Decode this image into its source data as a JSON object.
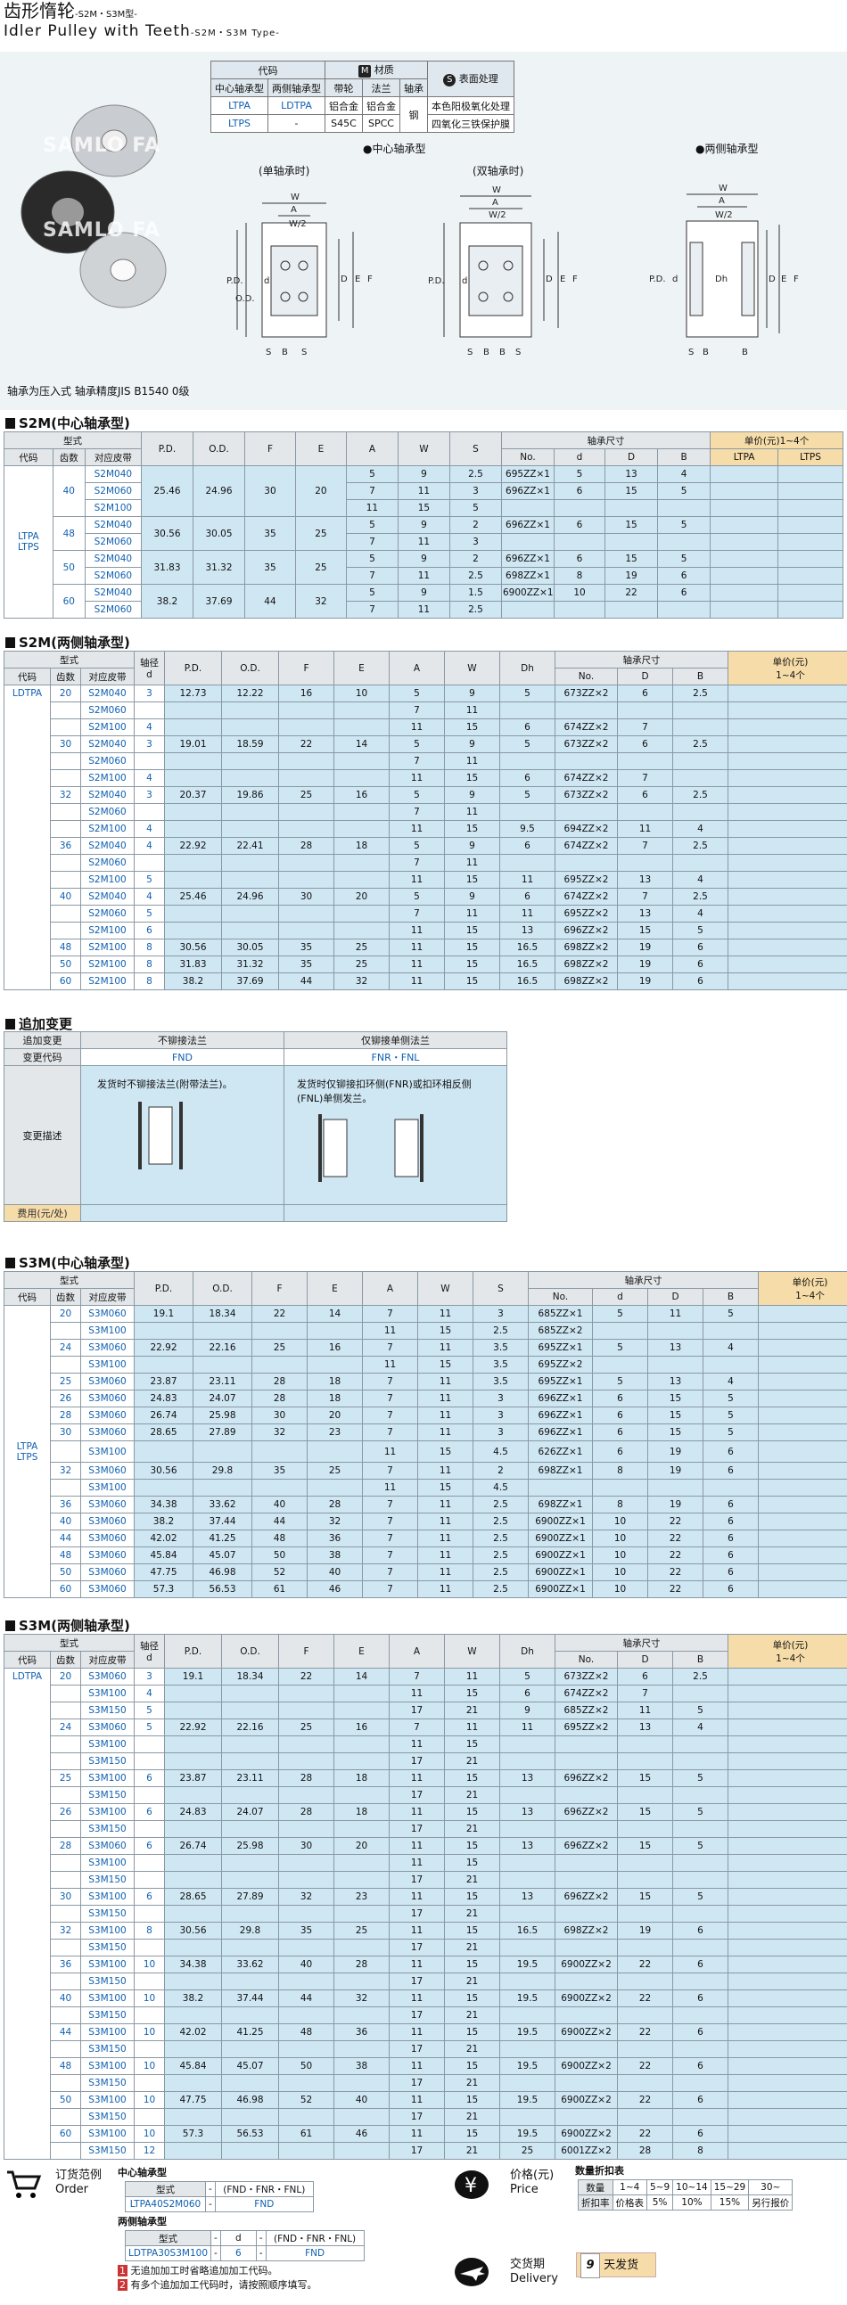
{
  "header": {
    "title_cn": "齿形惰轮",
    "title_cn_suffix": "-S2M・S3M型-",
    "title_en": "Idler Pulley with Teeth",
    "title_en_suffix": "-S2M・S3M Type-"
  },
  "materials": {
    "code": "代码",
    "material": "材质",
    "surface": "表面处理",
    "center_type": "中心轴承型",
    "both_type": "两侧轴承型",
    "belt": "带轮",
    "flange": "法兰",
    "bearing": "轴承",
    "rows": [
      [
        "LTPA",
        "LDTPA",
        "铝合金",
        "铝合金",
        "钢",
        "本色阳极氧化处理"
      ],
      [
        "LTPS",
        "-",
        "S45C",
        "SPCC",
        "",
        "四氧化三铁保护膜"
      ]
    ]
  },
  "drawings": {
    "center": "●中心轴承型",
    "both": "●两侧轴承型",
    "single": "(单轴承时)",
    "double": "(双轴承时)"
  },
  "bearing_note": "轴承为压入式 轴承精度JIS B1540 0级",
  "s2m_center": {
    "title": "S2M(中心轴承型)",
    "type": "型式",
    "code": "代码",
    "teeth": "齿数",
    "belt": "对应皮带",
    "pd": "P.D.",
    "od": "O.D.",
    "f": "F",
    "e": "E",
    "a": "A",
    "w": "W",
    "s": "S",
    "bearing": "轴承尺寸",
    "no": "No.",
    "d": "d",
    "D": "D",
    "B": "B",
    "price": "单价(元)1~4个",
    "p1": "LTPA",
    "p2": "LTPS",
    "codes": [
      "LTPA",
      "LTPS"
    ],
    "groups": [
      {
        "teeth": "40",
        "pd": "25.46",
        "od": "24.96",
        "f": "30",
        "e": "20",
        "rows": [
          [
            "S2M040",
            "5",
            "9",
            "2.5",
            "695ZZ×1",
            "5",
            "13",
            "4"
          ],
          [
            "S2M060",
            "7",
            "11",
            "3",
            "696ZZ×1",
            "6",
            "15",
            "5"
          ],
          [
            "S2M100",
            "11",
            "15",
            "5",
            "",
            "",
            "",
            ""
          ]
        ]
      },
      {
        "teeth": "48",
        "pd": "30.56",
        "od": "30.05",
        "f": "35",
        "e": "25",
        "rows": [
          [
            "S2M040",
            "5",
            "9",
            "2",
            "696ZZ×1",
            "6",
            "15",
            "5"
          ],
          [
            "S2M060",
            "7",
            "11",
            "3",
            "",
            "",
            "",
            ""
          ]
        ]
      },
      {
        "teeth": "50",
        "pd": "31.83",
        "od": "31.32",
        "f": "35",
        "e": "25",
        "rows": [
          [
            "S2M040",
            "5",
            "9",
            "2",
            "696ZZ×1",
            "6",
            "15",
            "5"
          ],
          [
            "S2M060",
            "7",
            "11",
            "2.5",
            "698ZZ×1",
            "8",
            "19",
            "6"
          ]
        ]
      },
      {
        "teeth": "60",
        "pd": "38.2",
        "od": "37.69",
        "f": "44",
        "e": "32",
        "rows": [
          [
            "S2M040",
            "5",
            "9",
            "1.5",
            "6900ZZ×1",
            "10",
            "22",
            "6"
          ],
          [
            "S2M060",
            "7",
            "11",
            "2.5",
            "",
            "",
            "",
            ""
          ]
        ]
      }
    ]
  },
  "s2m_both": {
    "title": "S2M(两侧轴承型)",
    "shaft": "轴径",
    "price": "单价(元)",
    "price2": "1~4个",
    "dh": "Dh",
    "code": "LDTPA",
    "rows": [
      [
        "20",
        "S2M040",
        "3",
        "12.73",
        "12.22",
        "16",
        "10",
        "5",
        "9",
        "5",
        "673ZZ×2",
        "6",
        "2.5"
      ],
      [
        "",
        "S2M060",
        "",
        "",
        "",
        "",
        "",
        "7",
        "11",
        "",
        "",
        "",
        ""
      ],
      [
        "",
        "S2M100",
        "4",
        "",
        "",
        "",
        "",
        "11",
        "15",
        "6",
        "674ZZ×2",
        "7",
        ""
      ],
      [
        "30",
        "S2M040",
        "3",
        "19.01",
        "18.59",
        "22",
        "14",
        "5",
        "9",
        "5",
        "673ZZ×2",
        "6",
        "2.5"
      ],
      [
        "",
        "S2M060",
        "",
        "",
        "",
        "",
        "",
        "7",
        "11",
        "",
        "",
        "",
        ""
      ],
      [
        "",
        "S2M100",
        "4",
        "",
        "",
        "",
        "",
        "11",
        "15",
        "6",
        "674ZZ×2",
        "7",
        ""
      ],
      [
        "32",
        "S2M040",
        "3",
        "20.37",
        "19.86",
        "25",
        "16",
        "5",
        "9",
        "5",
        "673ZZ×2",
        "6",
        "2.5"
      ],
      [
        "",
        "S2M060",
        "",
        "",
        "",
        "",
        "",
        "7",
        "11",
        "",
        "",
        "",
        ""
      ],
      [
        "",
        "S2M100",
        "4",
        "",
        "",
        "",
        "",
        "11",
        "15",
        "9.5",
        "694ZZ×2",
        "11",
        "4"
      ],
      [
        "36",
        "S2M040",
        "4",
        "22.92",
        "22.41",
        "28",
        "18",
        "5",
        "9",
        "6",
        "674ZZ×2",
        "7",
        "2.5"
      ],
      [
        "",
        "S2M060",
        "",
        "",
        "",
        "",
        "",
        "7",
        "11",
        "",
        "",
        "",
        ""
      ],
      [
        "",
        "S2M100",
        "5",
        "",
        "",
        "",
        "",
        "11",
        "15",
        "11",
        "695ZZ×2",
        "13",
        "4"
      ],
      [
        "40",
        "S2M040",
        "4",
        "25.46",
        "24.96",
        "30",
        "20",
        "5",
        "9",
        "6",
        "674ZZ×2",
        "7",
        "2.5"
      ],
      [
        "",
        "S2M060",
        "5",
        "",
        "",
        "",
        "",
        "7",
        "11",
        "11",
        "695ZZ×2",
        "13",
        "4"
      ],
      [
        "",
        "S2M100",
        "6",
        "",
        "",
        "",
        "",
        "11",
        "15",
        "13",
        "696ZZ×2",
        "15",
        "5"
      ],
      [
        "48",
        "S2M100",
        "8",
        "30.56",
        "30.05",
        "35",
        "25",
        "11",
        "15",
        "16.5",
        "698ZZ×2",
        "19",
        "6"
      ],
      [
        "50",
        "S2M100",
        "8",
        "31.83",
        "31.32",
        "35",
        "25",
        "11",
        "15",
        "16.5",
        "698ZZ×2",
        "19",
        "6"
      ],
      [
        "60",
        "S2M100",
        "8",
        "38.2",
        "37.69",
        "44",
        "32",
        "11",
        "15",
        "16.5",
        "698ZZ×2",
        "19",
        "6"
      ]
    ]
  },
  "alteration": {
    "title": "追加变更",
    "item": "追加变更",
    "opt1": "不铆接法兰",
    "opt2": "仅铆接单侧法兰",
    "code_label": "变更代码",
    "code1": "FND",
    "code2": "FNR・FNL",
    "desc_label": "变更描述",
    "desc1": "发货时不铆接法兰(附带法兰)。",
    "desc2": "发货时仅铆接扣环侧(FNR)或扣环相反侧(FNL)单侧发兰。",
    "fee": "费用(元/处)"
  },
  "s3m_center": {
    "title": "S3M(中心轴承型)",
    "price": "单价(元)",
    "price2": "1~4个",
    "codes": [
      "LTPA",
      "LTPS"
    ],
    "rows": [
      [
        "20",
        "S3M060",
        "19.1",
        "18.34",
        "22",
        "14",
        "7",
        "11",
        "3",
        "685ZZ×1",
        "5",
        "11",
        "5"
      ],
      [
        "",
        "S3M100",
        "",
        "",
        "",
        "",
        "11",
        "15",
        "2.5",
        "685ZZ×2",
        "",
        "",
        ""
      ],
      [
        "24",
        "S3M060",
        "22.92",
        "22.16",
        "25",
        "16",
        "7",
        "11",
        "3.5",
        "695ZZ×1",
        "5",
        "13",
        "4"
      ],
      [
        "",
        "S3M100",
        "",
        "",
        "",
        "",
        "11",
        "15",
        "3.5",
        "695ZZ×2",
        "",
        "",
        ""
      ],
      [
        "25",
        "S3M060",
        "23.87",
        "23.11",
        "28",
        "18",
        "7",
        "11",
        "3.5",
        "695ZZ×1",
        "5",
        "13",
        "4"
      ],
      [
        "26",
        "S3M060",
        "24.83",
        "24.07",
        "28",
        "18",
        "7",
        "11",
        "3",
        "696ZZ×1",
        "6",
        "15",
        "5"
      ],
      [
        "28",
        "S3M060",
        "26.74",
        "25.98",
        "30",
        "20",
        "7",
        "11",
        "3",
        "696ZZ×1",
        "6",
        "15",
        "5"
      ],
      [
        "30",
        "S3M060",
        "28.65",
        "27.89",
        "32",
        "23",
        "7",
        "11",
        "3",
        "696ZZ×1",
        "6",
        "15",
        "5"
      ],
      [
        "",
        "S3M100",
        "",
        "",
        "",
        "",
        "11",
        "15",
        "4.5",
        "626ZZ×1",
        "6",
        "19",
        "6"
      ],
      [
        "32",
        "S3M060",
        "30.56",
        "29.8",
        "35",
        "25",
        "7",
        "11",
        "2",
        "698ZZ×1",
        "8",
        "19",
        "6"
      ],
      [
        "",
        "S3M100",
        "",
        "",
        "",
        "",
        "11",
        "15",
        "4.5",
        "",
        "",
        "",
        ""
      ],
      [
        "36",
        "S3M060",
        "34.38",
        "33.62",
        "40",
        "28",
        "7",
        "11",
        "2.5",
        "698ZZ×1",
        "8",
        "19",
        "6"
      ],
      [
        "40",
        "S3M060",
        "38.2",
        "37.44",
        "44",
        "32",
        "7",
        "11",
        "2.5",
        "6900ZZ×1",
        "10",
        "22",
        "6"
      ],
      [
        "44",
        "S3M060",
        "42.02",
        "41.25",
        "48",
        "36",
        "7",
        "11",
        "2.5",
        "6900ZZ×1",
        "10",
        "22",
        "6"
      ],
      [
        "48",
        "S3M060",
        "45.84",
        "45.07",
        "50",
        "38",
        "7",
        "11",
        "2.5",
        "6900ZZ×1",
        "10",
        "22",
        "6"
      ],
      [
        "50",
        "S3M060",
        "47.75",
        "46.98",
        "52",
        "40",
        "7",
        "11",
        "2.5",
        "6900ZZ×1",
        "10",
        "22",
        "6"
      ],
      [
        "60",
        "S3M060",
        "57.3",
        "56.53",
        "61",
        "46",
        "7",
        "11",
        "2.5",
        "6900ZZ×1",
        "10",
        "22",
        "6"
      ]
    ]
  },
  "s3m_both": {
    "title": "S3M(两侧轴承型)",
    "price": "单价(元)",
    "price2": "1~4个",
    "code": "LDTPA",
    "rows": [
      [
        "20",
        "S3M060",
        "3",
        "19.1",
        "18.34",
        "22",
        "14",
        "7",
        "11",
        "5",
        "673ZZ×2",
        "6",
        "2.5"
      ],
      [
        "",
        "S3M100",
        "4",
        "",
        "",
        "",
        "",
        "11",
        "15",
        "6",
        "674ZZ×2",
        "7",
        ""
      ],
      [
        "",
        "S3M150",
        "5",
        "",
        "",
        "",
        "",
        "17",
        "21",
        "9",
        "685ZZ×2",
        "11",
        "5"
      ],
      [
        "24",
        "S3M060",
        "5",
        "22.92",
        "22.16",
        "25",
        "16",
        "7",
        "11",
        "11",
        "695ZZ×2",
        "13",
        "4"
      ],
      [
        "",
        "S3M100",
        "",
        "",
        "",
        "",
        "",
        "11",
        "15",
        "",
        "",
        "",
        ""
      ],
      [
        "",
        "S3M150",
        "",
        "",
        "",
        "",
        "",
        "17",
        "21",
        "",
        "",
        "",
        ""
      ],
      [
        "25",
        "S3M100",
        "6",
        "23.87",
        "23.11",
        "28",
        "18",
        "11",
        "15",
        "13",
        "696ZZ×2",
        "15",
        "5"
      ],
      [
        "",
        "S3M150",
        "",
        "",
        "",
        "",
        "",
        "17",
        "21",
        "",
        "",
        "",
        ""
      ],
      [
        "26",
        "S3M100",
        "6",
        "24.83",
        "24.07",
        "28",
        "18",
        "11",
        "15",
        "13",
        "696ZZ×2",
        "15",
        "5"
      ],
      [
        "",
        "S3M150",
        "",
        "",
        "",
        "",
        "",
        "17",
        "21",
        "",
        "",
        "",
        ""
      ],
      [
        "28",
        "S3M060",
        "6",
        "26.74",
        "25.98",
        "30",
        "20",
        "11",
        "15",
        "13",
        "696ZZ×2",
        "15",
        "5"
      ],
      [
        "",
        "S3M100",
        "",
        "",
        "",
        "",
        "",
        "11",
        "15",
        "",
        "",
        "",
        ""
      ],
      [
        "",
        "S3M150",
        "",
        "",
        "",
        "",
        "",
        "17",
        "21",
        "",
        "",
        "",
        ""
      ],
      [
        "30",
        "S3M100",
        "6",
        "28.65",
        "27.89",
        "32",
        "23",
        "11",
        "15",
        "13",
        "696ZZ×2",
        "15",
        "5"
      ],
      [
        "",
        "S3M150",
        "",
        "",
        "",
        "",
        "",
        "17",
        "21",
        "",
        "",
        "",
        ""
      ],
      [
        "32",
        "S3M100",
        "8",
        "30.56",
        "29.8",
        "35",
        "25",
        "11",
        "15",
        "16.5",
        "698ZZ×2",
        "19",
        "6"
      ],
      [
        "",
        "S3M150",
        "",
        "",
        "",
        "",
        "",
        "17",
        "21",
        "",
        "",
        "",
        ""
      ],
      [
        "36",
        "S3M100",
        "10",
        "34.38",
        "33.62",
        "40",
        "28",
        "11",
        "15",
        "19.5",
        "6900ZZ×2",
        "22",
        "6"
      ],
      [
        "",
        "S3M150",
        "",
        "",
        "",
        "",
        "",
        "17",
        "21",
        "",
        "",
        "",
        ""
      ],
      [
        "40",
        "S3M100",
        "10",
        "38.2",
        "37.44",
        "44",
        "32",
        "11",
        "15",
        "19.5",
        "6900ZZ×2",
        "22",
        "6"
      ],
      [
        "",
        "S3M150",
        "",
        "",
        "",
        "",
        "",
        "17",
        "21",
        "",
        "",
        "",
        ""
      ],
      [
        "44",
        "S3M100",
        "10",
        "42.02",
        "41.25",
        "48",
        "36",
        "11",
        "15",
        "19.5",
        "6900ZZ×2",
        "22",
        "6"
      ],
      [
        "",
        "S3M150",
        "",
        "",
        "",
        "",
        "",
        "17",
        "21",
        "",
        "",
        "",
        ""
      ],
      [
        "48",
        "S3M100",
        "10",
        "45.84",
        "45.07",
        "50",
        "38",
        "11",
        "15",
        "19.5",
        "6900ZZ×2",
        "22",
        "6"
      ],
      [
        "",
        "S3M150",
        "",
        "",
        "",
        "",
        "",
        "17",
        "21",
        "",
        "",
        "",
        ""
      ],
      [
        "50",
        "S3M100",
        "10",
        "47.75",
        "46.98",
        "52",
        "40",
        "11",
        "15",
        "19.5",
        "6900ZZ×2",
        "22",
        "6"
      ],
      [
        "",
        "S3M150",
        "",
        "",
        "",
        "",
        "",
        "17",
        "21",
        "",
        "",
        "",
        ""
      ],
      [
        "60",
        "S3M100",
        "10",
        "57.3",
        "56.53",
        "61",
        "46",
        "11",
        "15",
        "19.5",
        "6900ZZ×2",
        "22",
        "6"
      ],
      [
        "",
        "S3M150",
        "12",
        "",
        "",
        "",
        "",
        "17",
        "21",
        "25",
        "6001ZZ×2",
        "28",
        "8"
      ]
    ]
  },
  "footer": {
    "order_cn": "订货范例",
    "order_en": "Order",
    "center": "中心轴承型",
    "both": "两侧轴承型",
    "type": "型式",
    "ex_head": [
      "型式",
      "-",
      "(FND・FNR・FNL)"
    ],
    "ex1": [
      "LTPA40S2M060",
      "-",
      "FND"
    ],
    "ex2_head": [
      "型式",
      "-",
      "d",
      "-",
      "(FND・FNR・FNL)"
    ],
    "ex2": [
      "LDTPA30S3M100",
      "-",
      "6",
      "-",
      "FND"
    ],
    "n1": "无追加加工时省略追加加工代码。",
    "n2": "有多个追加加工代码时，请按照顺序填写。",
    "price_cn": "价格(元)",
    "price_en": "Price",
    "disc_title": "数量折扣表",
    "qty": "数量",
    "q": [
      "1~4",
      "5~9",
      "10~14",
      "15~29",
      "30~"
    ],
    "rate": "折扣率",
    "r": [
      "价格表",
      "5%",
      "10%",
      "15%",
      "另行报价"
    ],
    "deliv_cn": "交货期",
    "deliv_en": "Delivery",
    "days": "9",
    "days_label": "天发货",
    "logo": "SAMLO FA"
  },
  "colors": {
    "header_bg": "#e4e7ea",
    "price_bg": "#f6dca8",
    "data_bg": "#cfe6f3",
    "link": "#1060b0"
  }
}
